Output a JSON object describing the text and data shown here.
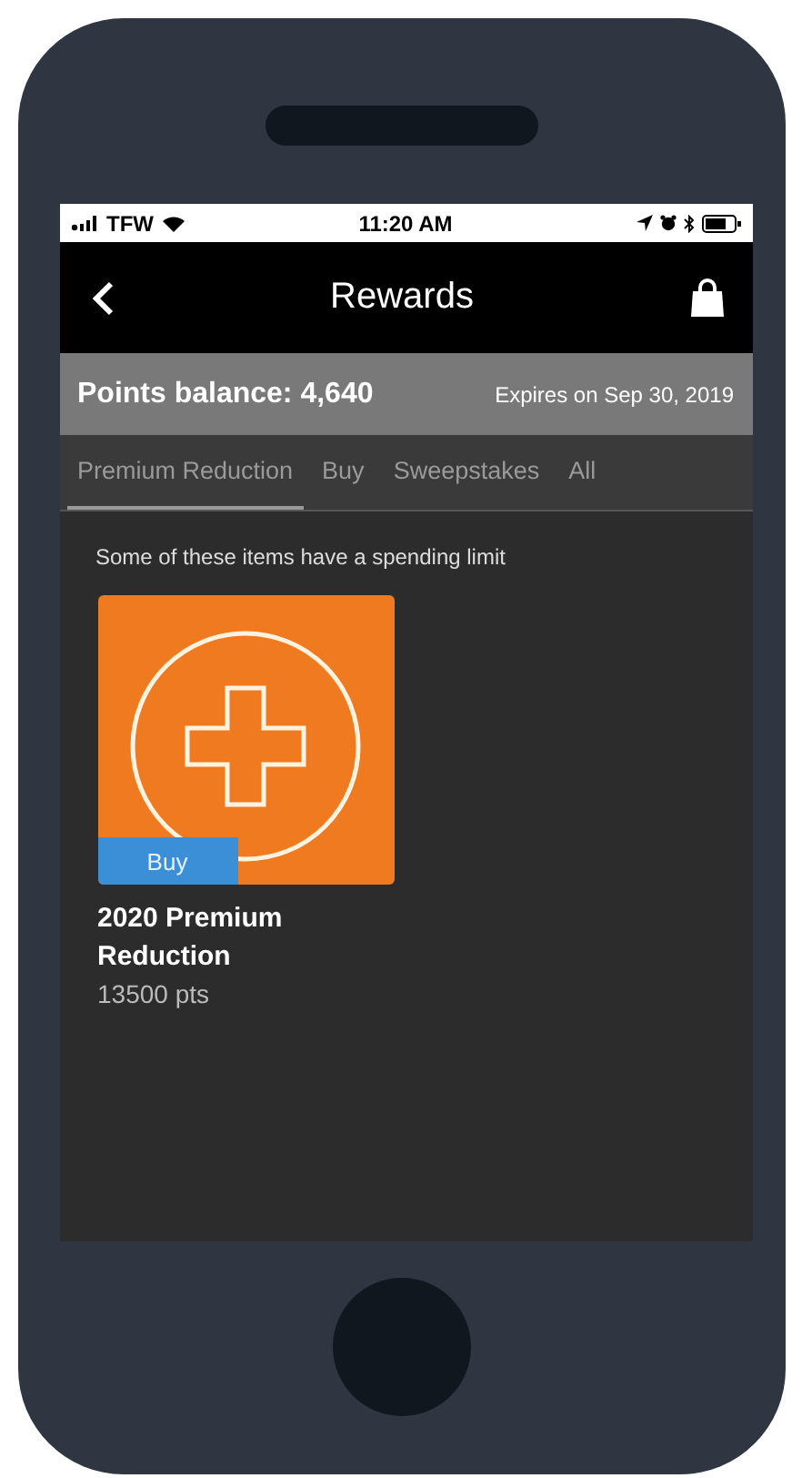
{
  "status_bar": {
    "carrier": "TFW",
    "time": "11:20 AM"
  },
  "nav": {
    "title": "Rewards"
  },
  "balance": {
    "label": "Points balance: 4,640",
    "expiry": "Expires on Sep 30, 2019"
  },
  "tabs": [
    {
      "label": "Premium Reduction",
      "selected": true
    },
    {
      "label": "Buy",
      "selected": false
    },
    {
      "label": "Sweepstakes",
      "selected": false
    },
    {
      "label": "All",
      "selected": false
    }
  ],
  "notice": "Some of these items have a spending limit",
  "items": [
    {
      "title": "2020 Premium Reduction",
      "points": "13500 pts",
      "action": "Buy"
    }
  ]
}
